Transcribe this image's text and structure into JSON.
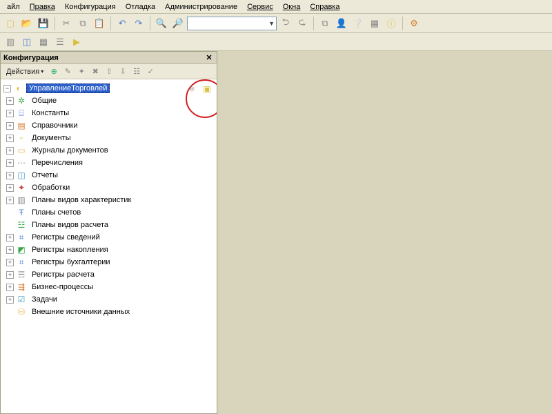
{
  "menu": {
    "items": [
      "айл",
      "Правка",
      "Конфигурация",
      "Отладка",
      "Администрирование",
      "Сервис",
      "Окна",
      "Справка"
    ]
  },
  "toolbar": {
    "icons": [
      "new-file",
      "open-file",
      "save",
      "sep",
      "cut",
      "copy",
      "paste",
      "sep",
      "undo",
      "redo",
      "sep",
      "find",
      "zoom",
      "combo",
      "sep",
      "step-over",
      "step-into",
      "sep",
      "copy-obj",
      "run-user",
      "help-q",
      "module",
      "info",
      "sep",
      "warn-config"
    ],
    "combo_value": ""
  },
  "toolbar2": {
    "icons": [
      "sql",
      "app",
      "grid",
      "tree",
      "play-menu"
    ]
  },
  "panel": {
    "title": "Конфигурация",
    "actions_label": "Действия",
    "tool_icons": [
      "add",
      "edit",
      "wand",
      "delete",
      "up",
      "down",
      "sort",
      "filter"
    ]
  },
  "tree": {
    "root": {
      "label": "УправлениеТорговлей",
      "selected": true
    },
    "items": [
      {
        "icon": "gear",
        "color": "ic-green",
        "label": "Общие",
        "expander": true
      },
      {
        "icon": "const",
        "color": "ic-blue",
        "label": "Константы",
        "expander": false
      },
      {
        "icon": "book",
        "color": "ic-orange",
        "label": "Справочники",
        "expander": true
      },
      {
        "icon": "doc",
        "color": "ic-yellow",
        "label": "Документы",
        "expander": false
      },
      {
        "icon": "journal",
        "color": "ic-folder",
        "label": "Журналы документов",
        "expander": true
      },
      {
        "icon": "enum",
        "color": "ic-gray",
        "label": "Перечисления",
        "expander": false
      },
      {
        "icon": "report",
        "color": "ic-cyan",
        "label": "Отчеты",
        "expander": false
      },
      {
        "icon": "proc",
        "color": "ic-red",
        "label": "Обработки",
        "expander": false
      },
      {
        "icon": "plan",
        "color": "ic-gray",
        "label": "Планы видов характеристик",
        "expander": true
      },
      {
        "icon": "accplan",
        "color": "ic-blue",
        "label": "Планы счетов",
        "expander": false,
        "noexpander": true
      },
      {
        "icon": "calc",
        "color": "ic-green",
        "label": "Планы видов расчета",
        "expander": false,
        "noexpander": true
      },
      {
        "icon": "reg",
        "color": "ic-blue",
        "label": "Регистры сведений",
        "expander": false
      },
      {
        "icon": "accum",
        "color": "ic-green",
        "label": "Регистры накопления",
        "expander": false
      },
      {
        "icon": "acct",
        "color": "ic-blue",
        "label": "Регистры бухгалтерии",
        "expander": false
      },
      {
        "icon": "regcalc",
        "color": "ic-gray",
        "label": "Регистры расчета",
        "expander": false
      },
      {
        "icon": "biz",
        "color": "ic-orange",
        "label": "Бизнес-процессы",
        "expander": true
      },
      {
        "icon": "task",
        "color": "ic-cyan",
        "label": "Задачи",
        "expander": false
      },
      {
        "icon": "ext",
        "color": "ic-folder",
        "label": "Внешние источники данных",
        "expander": false,
        "noexpander": true
      }
    ]
  }
}
